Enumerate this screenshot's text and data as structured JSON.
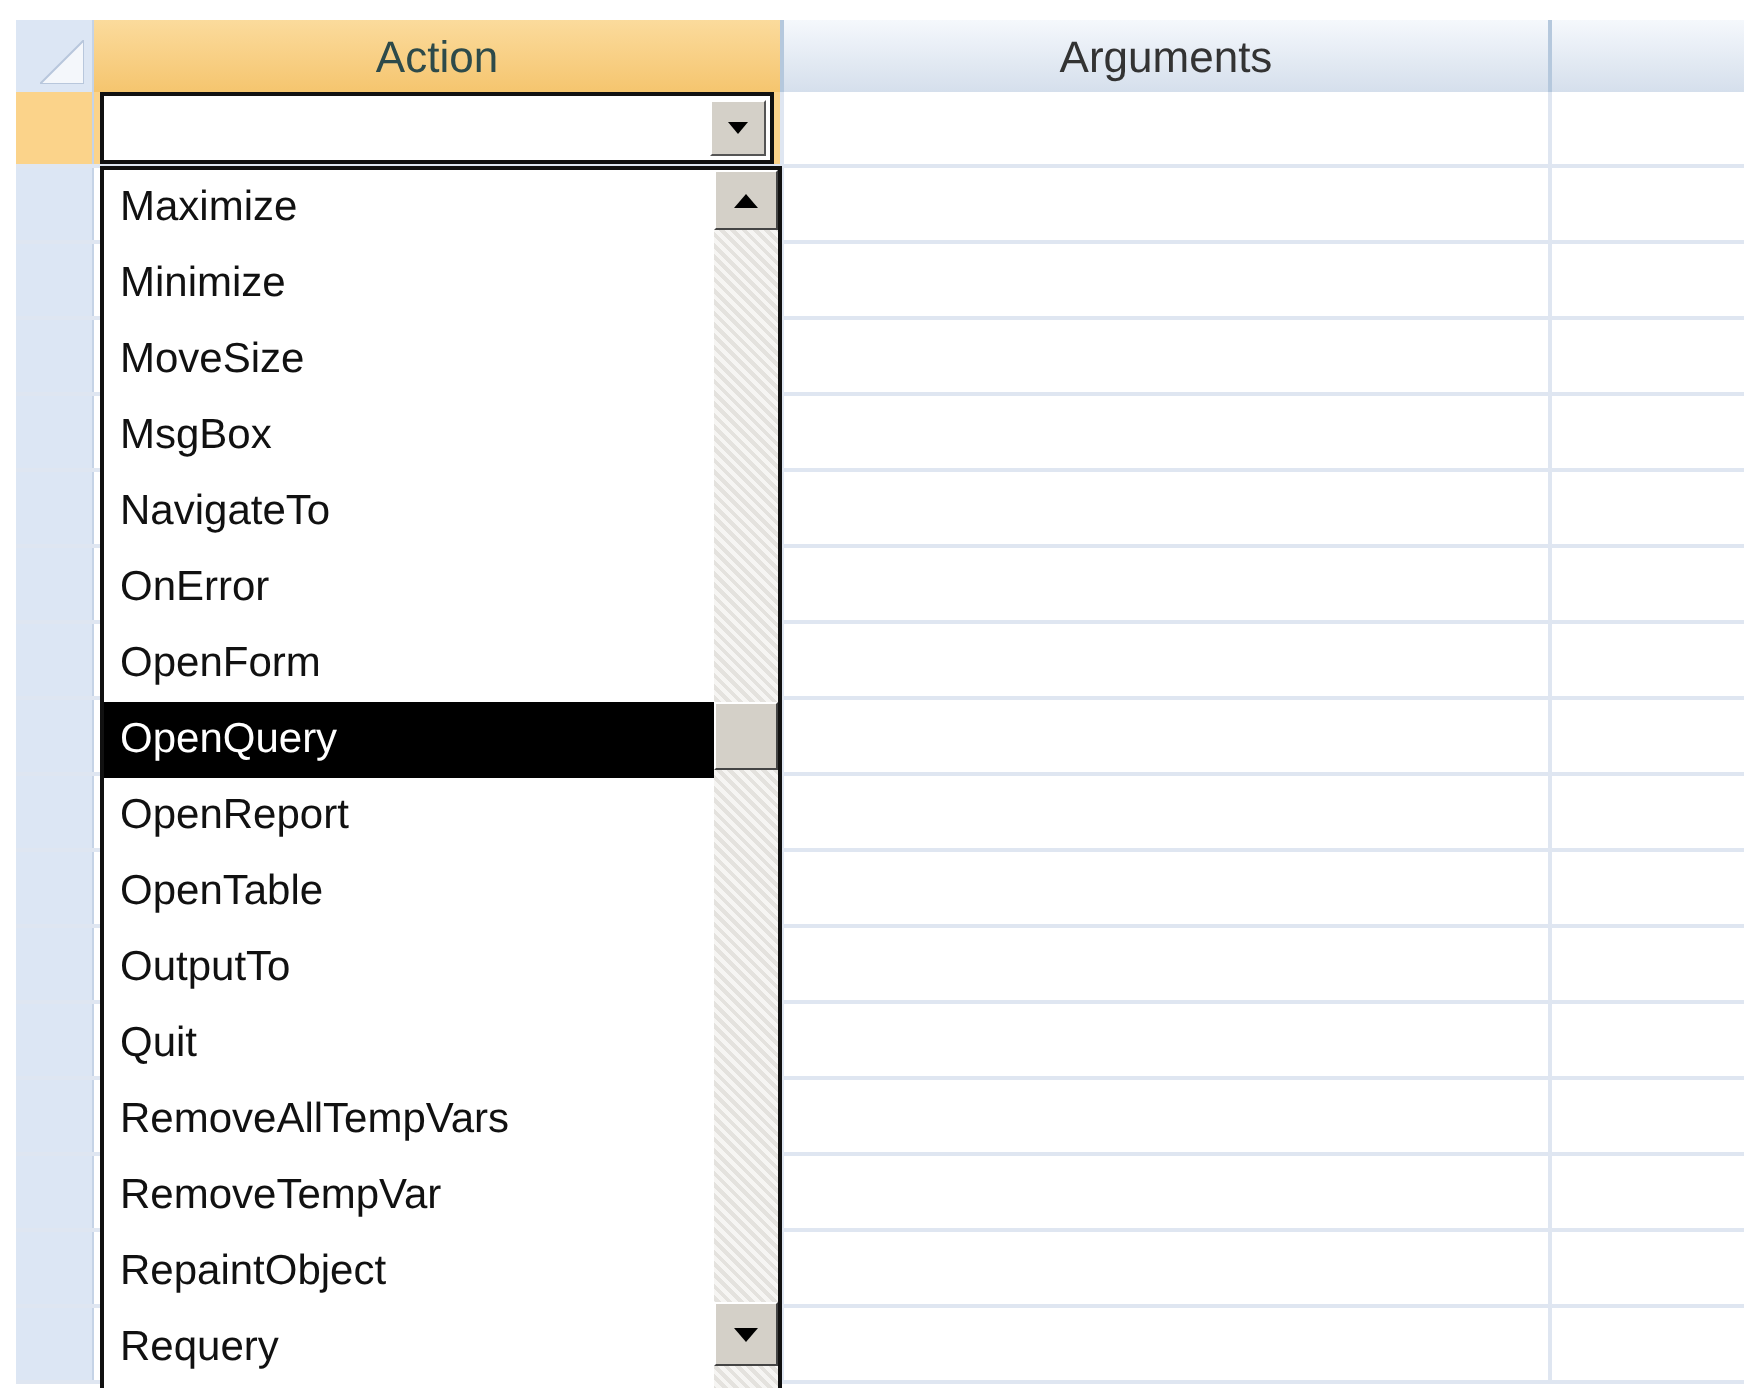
{
  "columns": [
    {
      "label": "Action",
      "selected": true
    },
    {
      "label": "Arguments",
      "selected": false
    }
  ],
  "dropdown": {
    "items": [
      {
        "label": "Maximize",
        "selected": false
      },
      {
        "label": "Minimize",
        "selected": false
      },
      {
        "label": "MoveSize",
        "selected": false
      },
      {
        "label": "MsgBox",
        "selected": false
      },
      {
        "label": "NavigateTo",
        "selected": false
      },
      {
        "label": "OnError",
        "selected": false
      },
      {
        "label": "OpenForm",
        "selected": false
      },
      {
        "label": "OpenQuery",
        "selected": true
      },
      {
        "label": "OpenReport",
        "selected": false
      },
      {
        "label": "OpenTable",
        "selected": false
      },
      {
        "label": "OutputTo",
        "selected": false
      },
      {
        "label": "Quit",
        "selected": false
      },
      {
        "label": "RemoveAllTempVars",
        "selected": false
      },
      {
        "label": "RemoveTempVar",
        "selected": false
      },
      {
        "label": "RepaintObject",
        "selected": false
      },
      {
        "label": "Requery",
        "selected": false
      }
    ]
  }
}
